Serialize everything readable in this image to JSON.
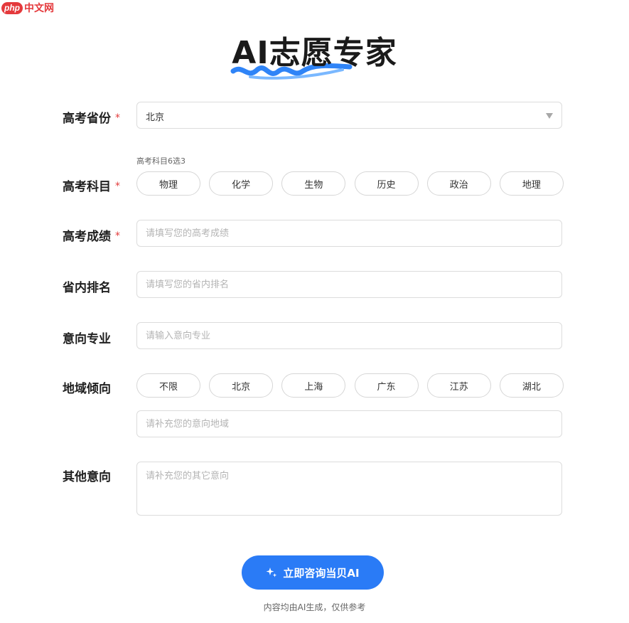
{
  "logo": {
    "php": "php",
    "cn": "中文网"
  },
  "title": "AI志愿专家",
  "form": {
    "province": {
      "label": "高考省份",
      "required": "*",
      "value": "北京"
    },
    "subjects": {
      "label": "高考科目",
      "required": "*",
      "hint": "高考科目6选3",
      "options": [
        "物理",
        "化学",
        "生物",
        "历史",
        "政治",
        "地理"
      ]
    },
    "score": {
      "label": "高考成绩",
      "required": "*",
      "placeholder": "请填写您的高考成绩"
    },
    "rank": {
      "label": "省内排名",
      "placeholder": "请填写您的省内排名"
    },
    "major": {
      "label": "意向专业",
      "placeholder": "请输入意向专业"
    },
    "region": {
      "label": "地域倾向",
      "options": [
        "不限",
        "北京",
        "上海",
        "广东",
        "江苏",
        "湖北"
      ],
      "placeholder": "请补充您的意向地域"
    },
    "other": {
      "label": "其他意向",
      "placeholder": "请补充您的其它意向"
    }
  },
  "submit": {
    "label": "立即咨询当贝AI",
    "icon": "sparkle-icon"
  },
  "footnote": "内容均由AI生成，仅供参考",
  "colors": {
    "accent": "#2a7bf6",
    "required": "#e23c3c",
    "brand": "#e4393c"
  }
}
